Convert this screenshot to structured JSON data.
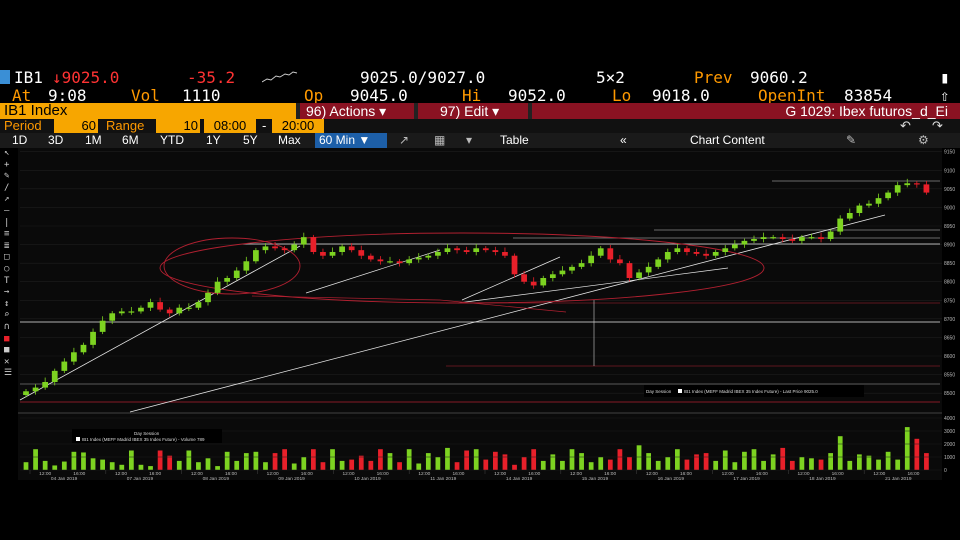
{
  "quote": {
    "ticker": "IB1",
    "last": "↓9025.0",
    "change": "-35.2",
    "bid_ask": "9025.0/9027.0",
    "size": "5×2",
    "prev_label": "Prev",
    "prev": "9060.2",
    "time_label": "At",
    "time": "9:08",
    "vol_label": "Vol",
    "vol": "1110",
    "op_label": "Op",
    "op": "9045.0",
    "hi_label": "Hi",
    "hi": "9052.0",
    "lo_label": "Lo",
    "lo": "9018.0",
    "oi_label": "OpenInt",
    "oi": "83854"
  },
  "toolbar": {
    "security": "IB1 Index",
    "actions": "96) Actions ▾",
    "edit": "97) Edit ▾",
    "chart_name": "G 1029: Ibex futuros_d_Ei",
    "period_label": "Period",
    "period": "60",
    "range_label": "Range",
    "range": "10",
    "time_from": "08:00",
    "time_sep": "-",
    "time_to": "20:00",
    "tabs": [
      "1D",
      "3D",
      "1M",
      "6M",
      "YTD",
      "1Y",
      "5Y",
      "Max"
    ],
    "interval": "60 Min ▼",
    "table": "Table",
    "chart_content": "Chart Content",
    "back": "«"
  },
  "chart_data": {
    "type": "candlestick",
    "title": "",
    "upper_legend": "IB1 Index (MEFF Madrid IBEX 35 Index Future) - Last Price 9025.0",
    "session": "Day Session",
    "lower_legend": "IB1 Index (MEFF Madrid IBEX 35 Index Future) - Volume 789",
    "ylim": [
      8460,
      9160
    ],
    "y_ticks": [
      8500,
      8550,
      8600,
      8650,
      8700,
      8750,
      8800,
      8850,
      8900,
      8950,
      9000,
      9050,
      9100,
      9150
    ],
    "volume_ylim": [
      0,
      4000
    ],
    "volume_ticks": [
      0,
      1000,
      2000,
      3000,
      4000
    ],
    "x_tick_labels": [
      "12:00",
      "16:00",
      "12:00",
      "16:00",
      "12:00",
      "16:00",
      "12:00",
      "16:00",
      "12:00",
      "16:00",
      "12:00",
      "16:00",
      "12:00",
      "16:00",
      "12:00",
      "16:00",
      "12:00",
      "16:00",
      "12:00",
      "16:00",
      "12:00",
      "16:00",
      "12:00",
      "16:00"
    ],
    "days": [
      "04 Jan 2019",
      "07 Jan 2019",
      "08 Jan 2019",
      "09 Jan 2019",
      "10 Jan 2019",
      "11 Jan 2019",
      "14 Jan 2019",
      "15 Jan 2019",
      "16 Jan 2019",
      "17 Jan 2019",
      "18 Jan 2019",
      "21 Jan 2019"
    ],
    "close": [
      8505,
      8515,
      8530,
      8560,
      8585,
      8610,
      8630,
      8665,
      8695,
      8715,
      8720,
      8720,
      8730,
      8745,
      8725,
      8715,
      8730,
      8730,
      8745,
      8770,
      8800,
      8810,
      8830,
      8855,
      8885,
      8895,
      8890,
      8885,
      8900,
      8920,
      8880,
      8870,
      8880,
      8895,
      8885,
      8870,
      8860,
      8855,
      8855,
      8850,
      8860,
      8865,
      8870,
      8880,
      8890,
      8885,
      8880,
      8890,
      8885,
      8880,
      8870,
      8820,
      8800,
      8790,
      8810,
      8820,
      8830,
      8840,
      8850,
      8870,
      8890,
      8860,
      8850,
      8810,
      8825,
      8840,
      8860,
      8880,
      8890,
      8880,
      8875,
      8870,
      8880,
      8890,
      8900,
      8910,
      8915,
      8920,
      8920,
      8915,
      8910,
      8920,
      8920,
      8915,
      8935,
      8970,
      8985,
      9005,
      9010,
      9025,
      9040,
      9060,
      9065,
      9062,
      9040
    ],
    "volume": [
      600,
      1600,
      700,
      350,
      650,
      1400,
      1350,
      900,
      800,
      600,
      400,
      1500,
      400,
      300,
      1500,
      1100,
      700,
      1500,
      600,
      900,
      300,
      1400,
      700,
      1300,
      1400,
      600,
      1300,
      1600,
      500,
      1000,
      1600,
      600,
      1600,
      700,
      800,
      1100,
      700,
      1600,
      1300,
      600,
      1600,
      500,
      1300,
      1000,
      1700,
      600,
      1500,
      1600,
      800,
      1400,
      1200,
      400,
      1000,
      1600,
      700,
      1200,
      700,
      1600,
      1300,
      600,
      1000,
      800,
      1600,
      1000,
      1900,
      1300,
      700,
      1000,
      1600,
      800,
      1200,
      1300,
      700,
      1500,
      600,
      1400,
      1600,
      700,
      1200,
      1700,
      700,
      1000,
      900,
      800,
      1300,
      2600,
      700,
      1200,
      1100,
      800,
      1400,
      800,
      3300,
      2400,
      1300
    ]
  },
  "colors": {
    "up": "#7dd321",
    "down": "#e8202a",
    "accent": "#f90"
  }
}
